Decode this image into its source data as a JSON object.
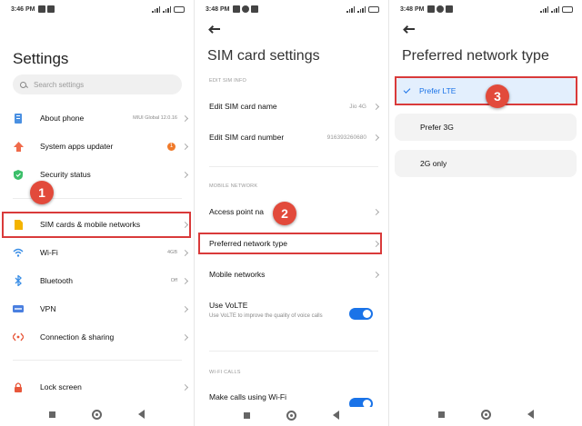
{
  "panels": {
    "settings": {
      "status_time": "3:46 PM",
      "title": "Settings",
      "search_placeholder": "Search settings",
      "items": [
        {
          "label": "About phone",
          "value": "MIUI Global 12.0.16"
        },
        {
          "label": "System apps updater",
          "badge": "1"
        },
        {
          "label": "Security status"
        },
        {
          "label": "SIM cards & mobile networks"
        },
        {
          "label": "Wi-Fi",
          "value": "4GB"
        },
        {
          "label": "Bluetooth",
          "value": "Off"
        },
        {
          "label": "VPN"
        },
        {
          "label": "Connection & sharing"
        },
        {
          "label": "Lock screen"
        }
      ],
      "step": "1"
    },
    "sim": {
      "status_time": "3:48 PM",
      "title": "SIM card settings",
      "section_edit": "EDIT SIM INFO",
      "edit_name_label": "Edit SIM card name",
      "edit_name_value": "Jio 4G",
      "edit_number_label": "Edit SIM card number",
      "edit_number_value": "916393260680",
      "section_mobile": "MOBILE NETWORK",
      "apn_label": "Access point na",
      "pref_label": "Preferred network type",
      "mobile_networks_label": "Mobile networks",
      "volte_label": "Use VoLTE",
      "volte_sub": "Use VoLTE to improve the quality of voice calls",
      "section_wifi": "WI-FI CALLS",
      "wifi_calls_label": "Make calls using Wi-Fi",
      "step": "2"
    },
    "network": {
      "status_time": "3:48 PM",
      "title": "Preferred network type",
      "options": [
        {
          "label": "Prefer LTE",
          "selected": true
        },
        {
          "label": "Prefer 3G"
        },
        {
          "label": "2G only"
        }
      ],
      "step": "3"
    }
  },
  "colors": {
    "highlight": "#d93a3a",
    "step_badge": "#e24a3b",
    "accent": "#1a73e8"
  }
}
